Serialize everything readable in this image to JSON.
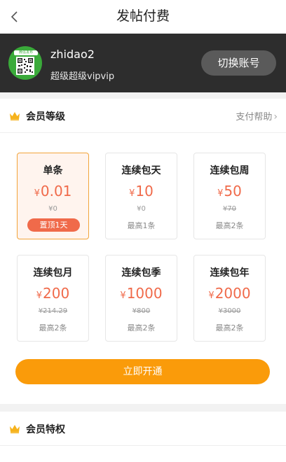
{
  "nav": {
    "title": "发帖付费"
  },
  "account": {
    "username": "zhidao2",
    "level": "超级超级vipvip",
    "switch_label": "切换账号",
    "avatar_tag": "微信发布"
  },
  "membership": {
    "title": "会员等级",
    "help_label": "支付帮助",
    "plans": [
      {
        "name": "单条",
        "yen": "¥",
        "price": "0.01",
        "original": "¥0",
        "note": "置顶1天"
      },
      {
        "name": "连续包天",
        "yen": "¥",
        "price": "10",
        "original": "¥0",
        "note": "最高1条"
      },
      {
        "name": "连续包周",
        "yen": "¥",
        "price": "50",
        "original": "¥70",
        "note": "最高2条"
      },
      {
        "name": "连续包月",
        "yen": "¥",
        "price": "200",
        "original": "¥214.29",
        "note": "最高2条"
      },
      {
        "name": "连续包季",
        "yen": "¥",
        "price": "1000",
        "original": "¥800",
        "note": "最高2条"
      },
      {
        "name": "连续包年",
        "yen": "¥",
        "price": "2000",
        "original": "¥3000",
        "note": "最高2条"
      }
    ],
    "open_label": "立即开通"
  },
  "privileges": {
    "title": "会员特权"
  },
  "colors": {
    "accent": "#fa9b0a",
    "price": "#f06a4a",
    "dark_bar": "#2d2d2d",
    "crown": "#f6b21b"
  }
}
